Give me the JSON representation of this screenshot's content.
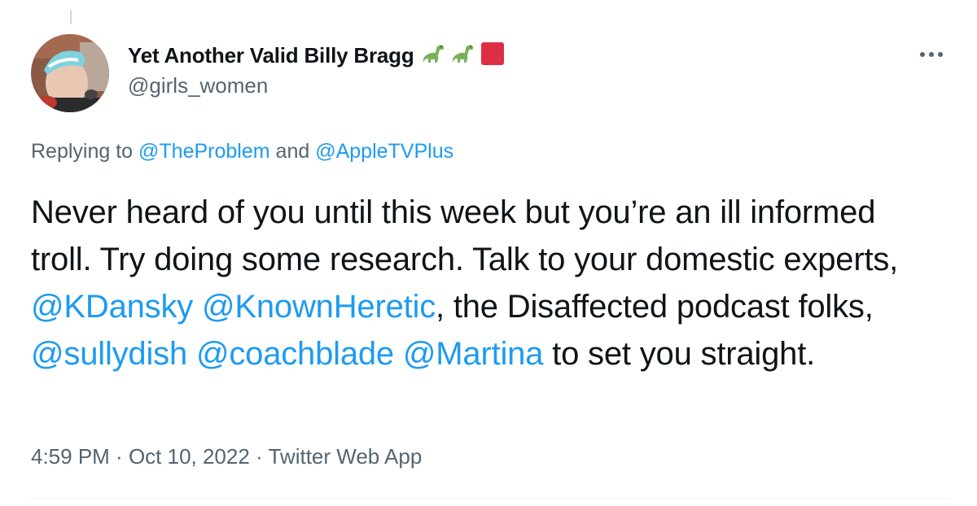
{
  "author": {
    "display_name": "Yet Another Valid Billy Bragg",
    "handle": "@girls_women",
    "name_emojis": [
      "dinosaur-icon",
      "dinosaur-icon",
      "red-square-icon"
    ]
  },
  "reply": {
    "prefix": "Replying to ",
    "mention_1": "@TheProblem",
    "joiner": " and ",
    "mention_2": "@AppleTVPlus"
  },
  "tweet": {
    "seg_1": "Never heard of you until this week but you’re an ill informed troll. Try doing some research. Talk to your domestic experts, ",
    "mention_kdansky": "@KDansky",
    "space_1": " ",
    "mention_knownheretic": "@KnownHeretic",
    "seg_2": ", the Disaffected podcast folks, ",
    "mention_sullydish": "@sullydish",
    "space_2": " ",
    "mention_coachblade": "@coachblade",
    "space_3": " ",
    "mention_martina": "@Martina",
    "seg_3": " to set you straight."
  },
  "meta": {
    "time": "4:59 PM",
    "sep_1": " · ",
    "date": "Oct 10, 2022",
    "sep_2": " · ",
    "source": "Twitter Web App"
  },
  "colors": {
    "link": "#1d9bf0",
    "secondary_text": "#536471",
    "primary_text": "#0f1419"
  },
  "icons": {
    "more": "more-horizontal-icon"
  }
}
